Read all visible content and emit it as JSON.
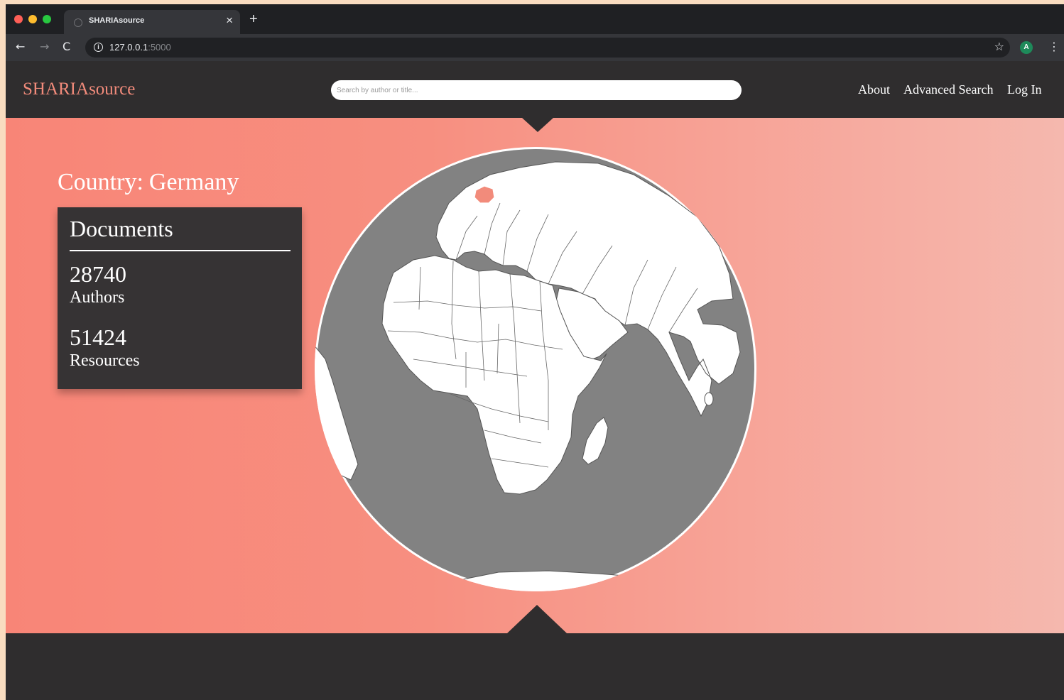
{
  "browser": {
    "tab_title": "SHARIAsource",
    "tab_close": "×",
    "new_tab": "+",
    "url_host": "127.0.0.1",
    "url_port": ":5000",
    "back_icon": "←",
    "forward_icon": "→",
    "reload_icon": "C",
    "info_icon": "i",
    "star_icon": "☆",
    "extension_letter": "A",
    "menu_icon": "⋮"
  },
  "header": {
    "logo": "SHARIAsource",
    "search_placeholder": "Search by author or title...",
    "nav": {
      "about": "About",
      "advanced_search": "Advanced Search",
      "login": "Log In"
    }
  },
  "hero": {
    "country_label": "Country:",
    "country_value": "Germany",
    "stats": {
      "heading": "Documents",
      "authors_value": "28740",
      "authors_label": "Authors",
      "resources_value": "51424",
      "resources_label": "Resources"
    }
  },
  "colors": {
    "accent": "#f28b7b",
    "dark": "#2f2d2e",
    "ocean": "#828282",
    "land": "#ffffff",
    "highlight": "#f28b7b"
  }
}
